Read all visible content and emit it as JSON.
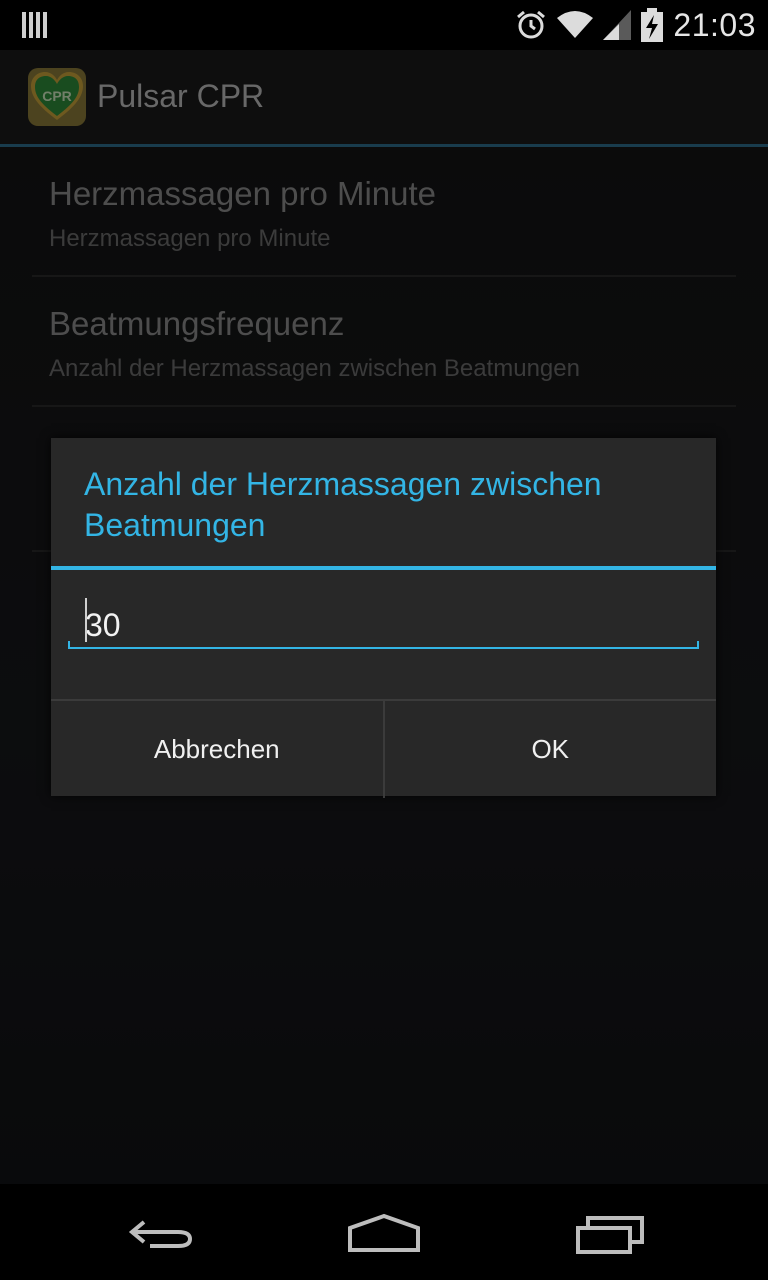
{
  "status_bar": {
    "time": "21:03",
    "icons": [
      "notification-bars-icon",
      "alarm-icon",
      "wifi-icon",
      "signal-icon",
      "battery-charging-icon"
    ]
  },
  "app": {
    "icon_label": "CPR",
    "title": "Pulsar CPR"
  },
  "preferences": [
    {
      "title": "Herzmassagen pro Minute",
      "summary": "Herzmassagen pro Minute"
    },
    {
      "title": "Beatmungsfrequenz",
      "summary": "Anzahl der Herzmassagen zwischen Beatmungen"
    },
    {
      "title": "",
      "summary": ""
    }
  ],
  "dialog": {
    "title": "Anzahl der Herzmassagen zwischen Beatmungen",
    "input_value": "30",
    "cancel_label": "Abbrechen",
    "ok_label": "OK"
  },
  "colors": {
    "accent": "#33b5e5",
    "dialog_bg": "#282828",
    "icon_green": "#2e8b3a",
    "icon_gold": "#c9a23a"
  },
  "navigation": [
    "back-icon",
    "home-icon",
    "recent-apps-icon"
  ]
}
